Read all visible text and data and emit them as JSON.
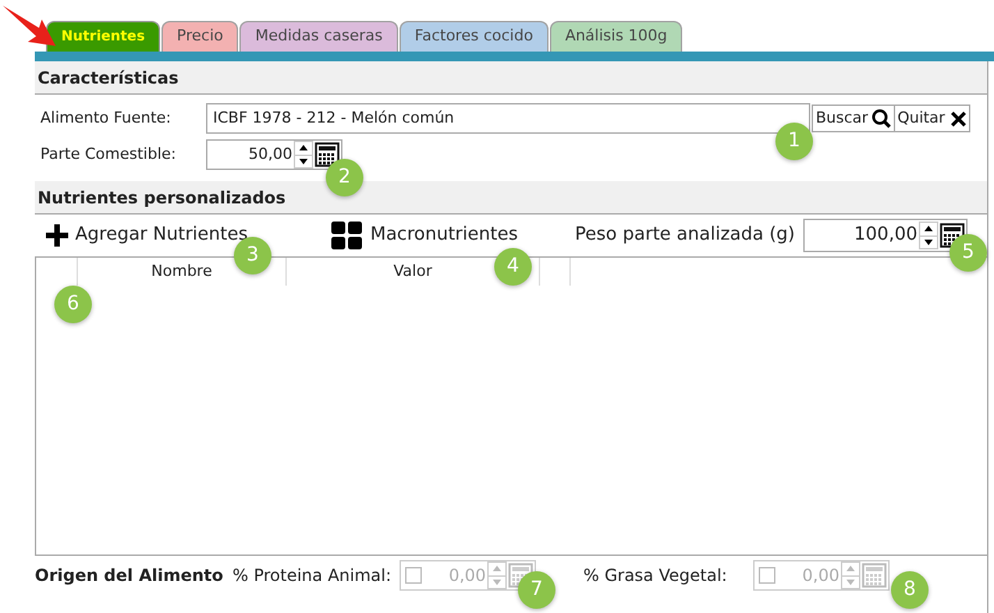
{
  "tabs": [
    {
      "label": "Nutrientes",
      "selected": true,
      "color": "#3a9a00"
    },
    {
      "label": "Precio",
      "selected": false,
      "color": "#f2a9a9"
    },
    {
      "label": "Medidas caseras",
      "selected": false,
      "color": "#d8b4d8"
    },
    {
      "label": "Factores cocido",
      "selected": false,
      "color": "#a9c8e6"
    },
    {
      "label": "Análisis 100g",
      "selected": false,
      "color": "#a8d4ac"
    }
  ],
  "caracteristicas": {
    "title": "Características",
    "alimento_label": "Alimento Fuente:",
    "alimento_value": "ICBF 1978 - 212 - Melón común",
    "buscar": "Buscar",
    "quitar": "Quitar",
    "parte_label": "Parte Comestible:",
    "parte_value": "50,00"
  },
  "personalizados": {
    "title": "Nutrientes personalizados",
    "agregar": "Agregar Nutrientes",
    "macro": "Macronutrientes",
    "peso_label": "Peso parte analizada (g)",
    "peso_value": "100,00"
  },
  "table": {
    "columns": [
      "Nombre",
      "Valor"
    ]
  },
  "origen": {
    "title": "Origen del Alimento",
    "fields": [
      {
        "label": "% Proteina Animal:",
        "value": "0,00",
        "checked": false,
        "disabled": true
      },
      {
        "label": "% Grasa Vegetal:",
        "value": "0,00",
        "checked": false,
        "disabled": true
      }
    ]
  },
  "callouts": [
    "1",
    "2",
    "3",
    "4",
    "5",
    "6",
    "7",
    "8"
  ]
}
